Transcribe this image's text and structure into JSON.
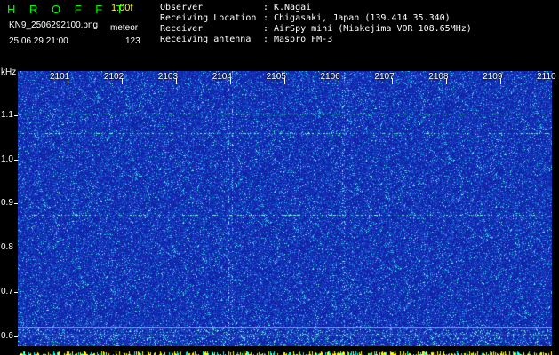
{
  "header": {
    "logo": "H R O F F T",
    "version": "1.00f",
    "filename": "KN9_2506292100.png",
    "mode": "meteor",
    "datetime": "25.06.29 21:00",
    "count": "123"
  },
  "info": [
    {
      "key": "Observer",
      "value": "K.Nagai"
    },
    {
      "key": "Receiving Location",
      "value": "Chigasaki, Japan (139.414 35.340)"
    },
    {
      "key": "Receiver",
      "value": "AirSpy mini (Miakejima VOR 108.65MHz)"
    },
    {
      "key": "Receiving antenna",
      "value": "Maspro FM-3"
    }
  ],
  "axis": {
    "unit": "kHz",
    "y_labels": [
      "1.1",
      "1.0",
      "0.9",
      "0.8",
      "0.7",
      "0.6"
    ],
    "time_labels": [
      "2101",
      "2102",
      "2103",
      "2104",
      "2105",
      "2106",
      "2107",
      "2108",
      "2109",
      "2110"
    ]
  },
  "colors": {
    "background": "#000000",
    "plot": "#1a2ab4",
    "logo": "#00ff00",
    "version": "#ffff00",
    "signal": "#33ffcc"
  }
}
